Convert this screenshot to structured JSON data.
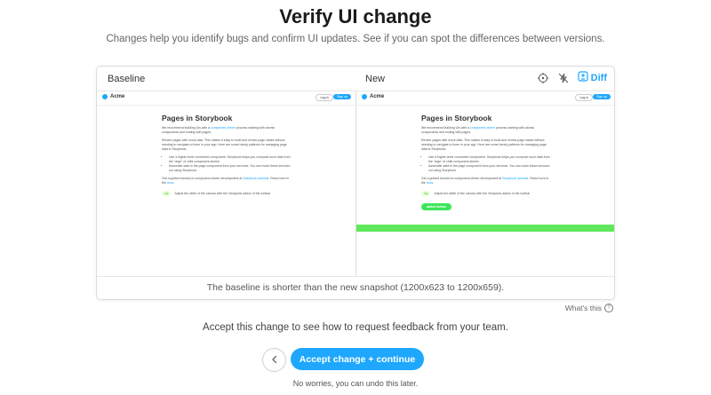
{
  "page": {
    "title": "Verify UI change",
    "subtitle": "Changes help you identify bugs and confirm UI updates. See if you can spot the differences between versions."
  },
  "compare": {
    "baseline_label": "Baseline",
    "new_label": "New",
    "icons": [
      "focus-target-icon",
      "strobe-off-icon",
      "diff-icon"
    ],
    "diff_label": "Diff",
    "footer_text": "The baseline is shorter than the new snapshot (1200x623 to 1200x659).",
    "accent_color": "#1ea7fd",
    "diff_highlight_color": "#5fe85b"
  },
  "snapshot": {
    "logo_text": "Acme",
    "login_label": "Log in",
    "signup_label": "Sign up",
    "heading": "Pages in Storybook",
    "para1_a": "We recommend building UIs with a ",
    "para1_link": "component-driven",
    "para1_b": " process starting with atomic components and ending with pages.",
    "para2": "Render pages with mock data. This makes it easy to build and review page states without needing to navigate to them in your app. Here are some handy patterns for managing page data in Storybook:",
    "bullets": [
      "Use a higher-level connected component. Storybook helps you compose such data from the \"args\" of child component stories",
      "Assemble data in the page component from your services. You can mock these services out using Storybook."
    ],
    "para3_a": "Get a guided tutorial on component-driven development at ",
    "para3_link": "Storybook tutorials",
    "para3_b": ". Read more in the ",
    "para3_link2": "docs",
    "para3_c": ".",
    "tip_badge": "Tip",
    "tip_text": "Adjust the width of the canvas with the  Viewports addon in the toolbar",
    "added_button": "added button"
  },
  "whats_this": "What's this",
  "prompt": "Accept this change to see how to request feedback from your team.",
  "actions": {
    "back_icon": "chevron-left-icon",
    "accept_label": "Accept change + continue",
    "undo_note": "No worries, you can undo this later."
  }
}
